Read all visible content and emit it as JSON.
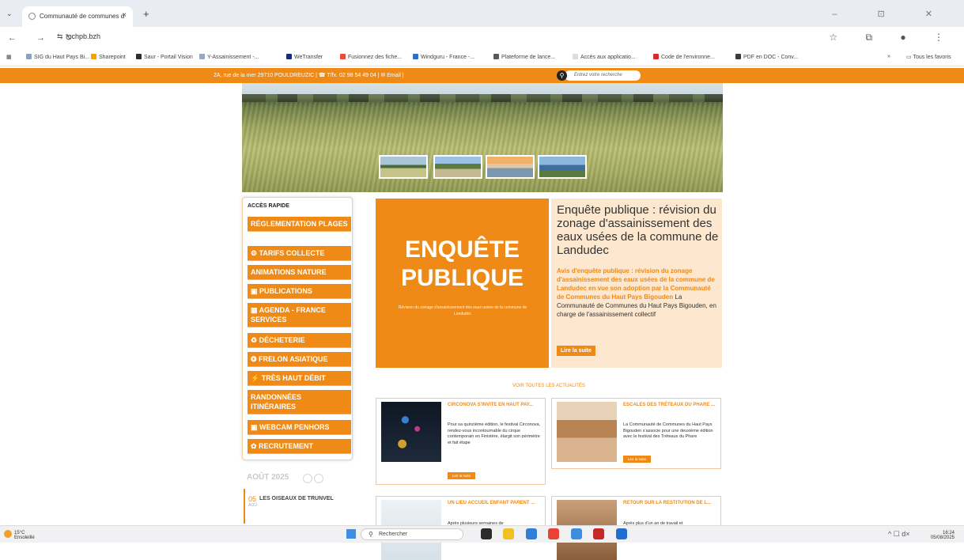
{
  "browser": {
    "tab_title": "Communauté de communes d",
    "tab_close": "×",
    "new_tab": "+",
    "tab_menu": "⌄",
    "window_controls": "–  ⊡  ✕",
    "nav_icons": "← → ↻",
    "url_icon": "⇆",
    "url": "cchpb.bzh",
    "right_icons": "☆ ⧉ ● ⋮",
    "bookmarks": [
      "SIG du Haut Pays Bi...",
      "Sharepoint",
      "Saur - Portail Vision",
      "Y-Assainissement -...",
      "WeTransfer",
      "Fusionnez des fiche...",
      "Windguru - France -...",
      "Plateforme de lance...",
      "Accès aux applicatio...",
      "Code de l'environne...",
      "PDF en DOC - Conv..."
    ],
    "bookmarks_more": "»",
    "all_bookmarks": "Tous les favoris",
    "bookmark_colors": [
      "#8aa1c1",
      "#f4a300",
      "#2d2d2d",
      "#9aa9b8",
      "#1a2b7b",
      "#e84a3c",
      "#2f6ec7",
      "#5a5a5a",
      "#dddddd",
      "#d62b2b",
      "#3a3a3a"
    ]
  },
  "site": {
    "contact_bar": "2A, rue de la mer 29710 POULDREUZIC  |  ☎ T/fx. 02 98 54 49 04  |  ✉ Email  |",
    "search_icon": "⚲",
    "search_placeholder": "Entrez votre recherche",
    "quick_access": {
      "title": "ACCÈS RAPIDE",
      "items": [
        "RÉGLEMENTATION PLAGES",
        "⚙ TARIFS COLLECTE",
        "ANIMATIONS NATURE",
        "▣ PUBLICATIONS",
        "▦ AGENDA - FRANCE SERVICES",
        "♻ DÉCHETERIE",
        "❂ FRELON ASIATIQUE",
        "⚡ TRÈS HAUT DÉBIT",
        "RANDONNÉES ITINÉRAIRES",
        "▣ WEBCAM PENHORS",
        "✿ RECRUTEMENT"
      ]
    },
    "agenda": {
      "month": "AOÛT 2025",
      "event_day": "05",
      "event_month": "AOÛ",
      "event_title": "LES OISEAUX DE TRUNVEL"
    },
    "featured": {
      "big_line1": "ENQUÊTE",
      "big_line2": "PUBLIQUE",
      "small_caption": "Révision du zonage d'assainissement des eaux usées de la commune de Landudec",
      "title": "Enquête publique : révision du zonage d'assainissement des eaux usées de la commune de Landudec",
      "body_highlight": "Avis d'enquête publique : révision du zonage d'assainissement des eaux usées de la commune de Landudec en vue son adoption par la Communauté de Communes du Haut Pays Bigouden",
      "body_text": " La Communauté de Communes du Haut Pays Bigouden, en charge de l'assainissement collectif",
      "read_more": "Lire la suite"
    },
    "see_all": "VOIR TOUTES LES ACTUALITÉS",
    "news": [
      {
        "title": "CIRCONOVA S'INVITE EN HAUT PAY...",
        "text": "Pour sa quinzième édition, le festival Circonova, rendez-vous incontournable du cirque contemporain en Finistère, élargit son périmètre et fait étape",
        "btn": "Lire la suite"
      },
      {
        "title": "ESCALES DES TRÉTEAUX DU PHARE ...",
        "text": "La Communauté de Communes du Haut Pays Bigouden s'associe pour une deuxième édition avec le festival des Tréteaux du Phare",
        "btn": "Lire la suite"
      },
      {
        "title": "UN LIEU ACCUEIL ENFANT PARENT ...",
        "text": "Après plusieurs semaines de",
        "btn": ""
      },
      {
        "title": "RETOUR SUR LA RESTITUTION DE L...",
        "text": "Après plus d'un an de travail et",
        "btn": ""
      }
    ]
  },
  "taskbar": {
    "weather_temp": "15°C",
    "weather_desc": "Ensoleillé",
    "search_icon": "⚲",
    "search_label": "Rechercher",
    "tray_icons": "^ ☐ d×",
    "time": "16:24",
    "date": "05/08/2025",
    "app_colors": [
      "#2b2b2b",
      "#f3c022",
      "#2f7fd6",
      "#e94235",
      "#3e8ede",
      "#c62828",
      "#1f6fd1"
    ]
  }
}
